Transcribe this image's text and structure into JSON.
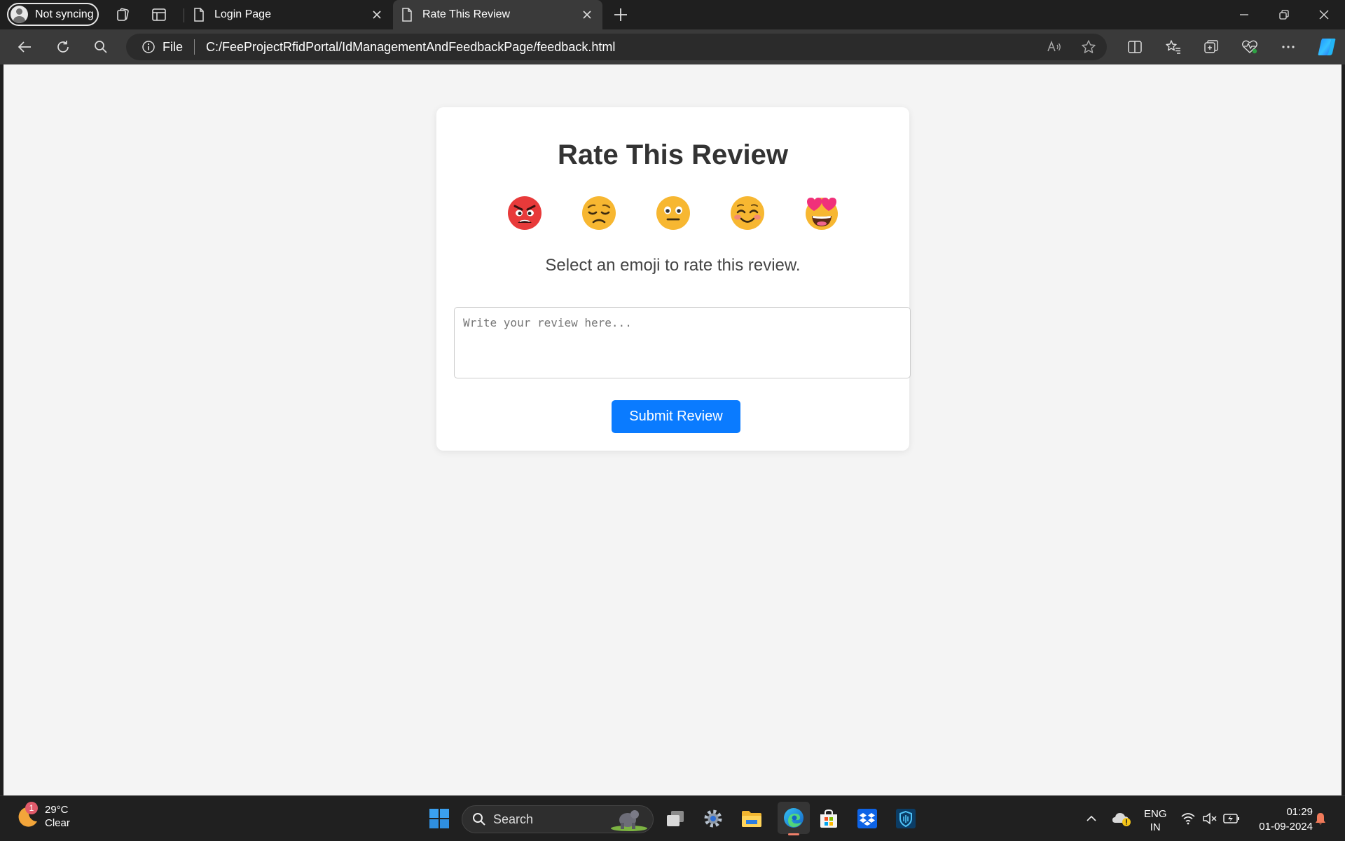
{
  "browser": {
    "profile_label": "Not syncing",
    "tabs": [
      {
        "title": "Login Page",
        "active": false
      },
      {
        "title": "Rate This Review",
        "active": true
      }
    ],
    "address": {
      "scheme_label": "File",
      "url": "C:/FeeProjectRfidPortal/IdManagementAndFeedbackPage/feedback.html"
    }
  },
  "page": {
    "title": "Rate This Review",
    "emojis": [
      {
        "icon": "angry-face-icon"
      },
      {
        "icon": "sad-face-icon"
      },
      {
        "icon": "neutral-face-icon"
      },
      {
        "icon": "smiling-face-icon"
      },
      {
        "icon": "heart-eyes-face-icon"
      }
    ],
    "prompt": "Select an emoji to rate this review.",
    "review_placeholder": "Write your review here...",
    "submit_label": "Submit Review",
    "colors": {
      "accent": "#0a7bff",
      "background": "#f4f4f4"
    }
  },
  "taskbar": {
    "weather": {
      "temp": "29°C",
      "condition": "Clear",
      "badge": "1"
    },
    "search_label": "Search",
    "language": {
      "line1": "ENG",
      "line2": "IN"
    },
    "clock": {
      "time": "01:29",
      "date": "01-09-2024"
    }
  }
}
